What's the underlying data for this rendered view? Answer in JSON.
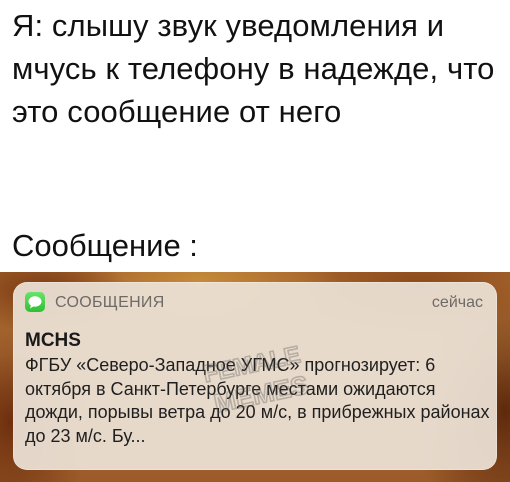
{
  "meme": {
    "caption_top": "Я: слышу звук уведомления и мчусь к телефону в надежде, что это сообщение от него",
    "caption_bottom": "Сообщение :"
  },
  "notification": {
    "app_name": "СООБЩЕНИЯ",
    "timestamp": "сейчас",
    "sender": "MCHS",
    "body": "ФГБУ «Северо-Западное УГМС» прогнозирует: 6 октября в Санкт-Петербурге местами ожидаются дожди, порывы ветра до 20 м/с, в прибрежных районах до 23 м/с. Бу...",
    "app_icon": "speech-bubble-icon",
    "app_icon_color": "#34c337"
  },
  "watermark": {
    "line1": "FEMALE",
    "line2": "MEMES"
  }
}
